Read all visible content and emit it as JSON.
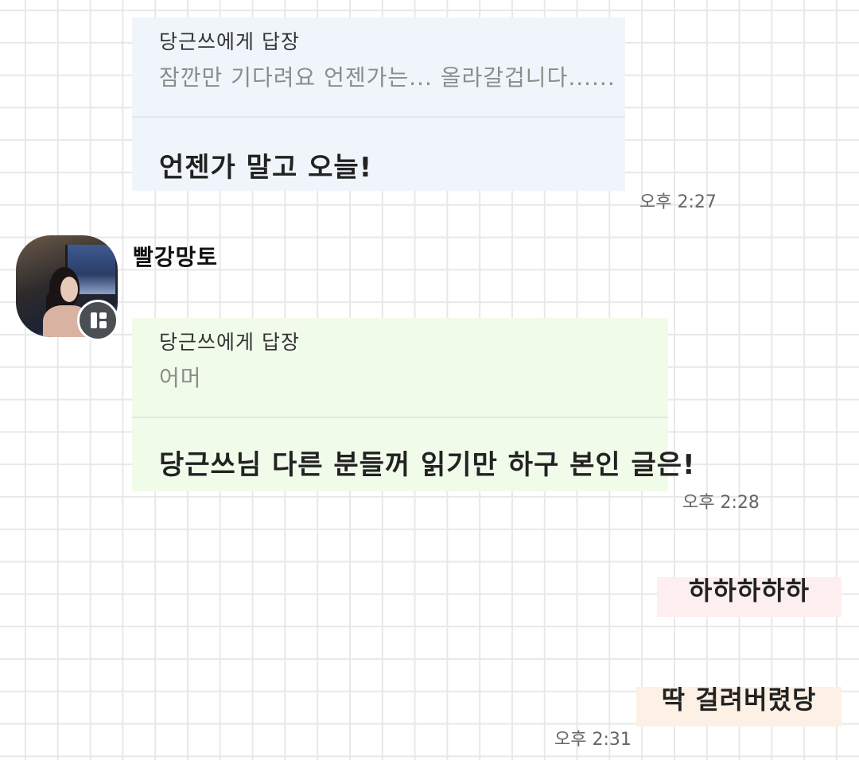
{
  "messages": [
    {
      "reply_target": "당근쓰에게 답장",
      "quote": "잠깐만 기다려요 언젠가는... 올라갈겁니다......",
      "text": "언젠가 말고 오늘!",
      "time": "오후 2:27",
      "color": "#eff5fa"
    },
    {
      "sender": "빨강망토",
      "reply_target": "당근쓰에게 답장",
      "quote": "어머",
      "text": "당근쓰님 다른 분들꺼 읽기만 하구 본인 글은!",
      "time": "오후 2:28",
      "color": "#f1fbea"
    },
    {
      "text": "하하하하하",
      "color": "#fdeeef"
    },
    {
      "text": "딱 걸려버렸당",
      "time": "오후 2:31",
      "color": "#fdf1e5"
    }
  ],
  "icons": {
    "avatar": "profile-photo",
    "badge": "kakao-channel-badge-icon"
  }
}
